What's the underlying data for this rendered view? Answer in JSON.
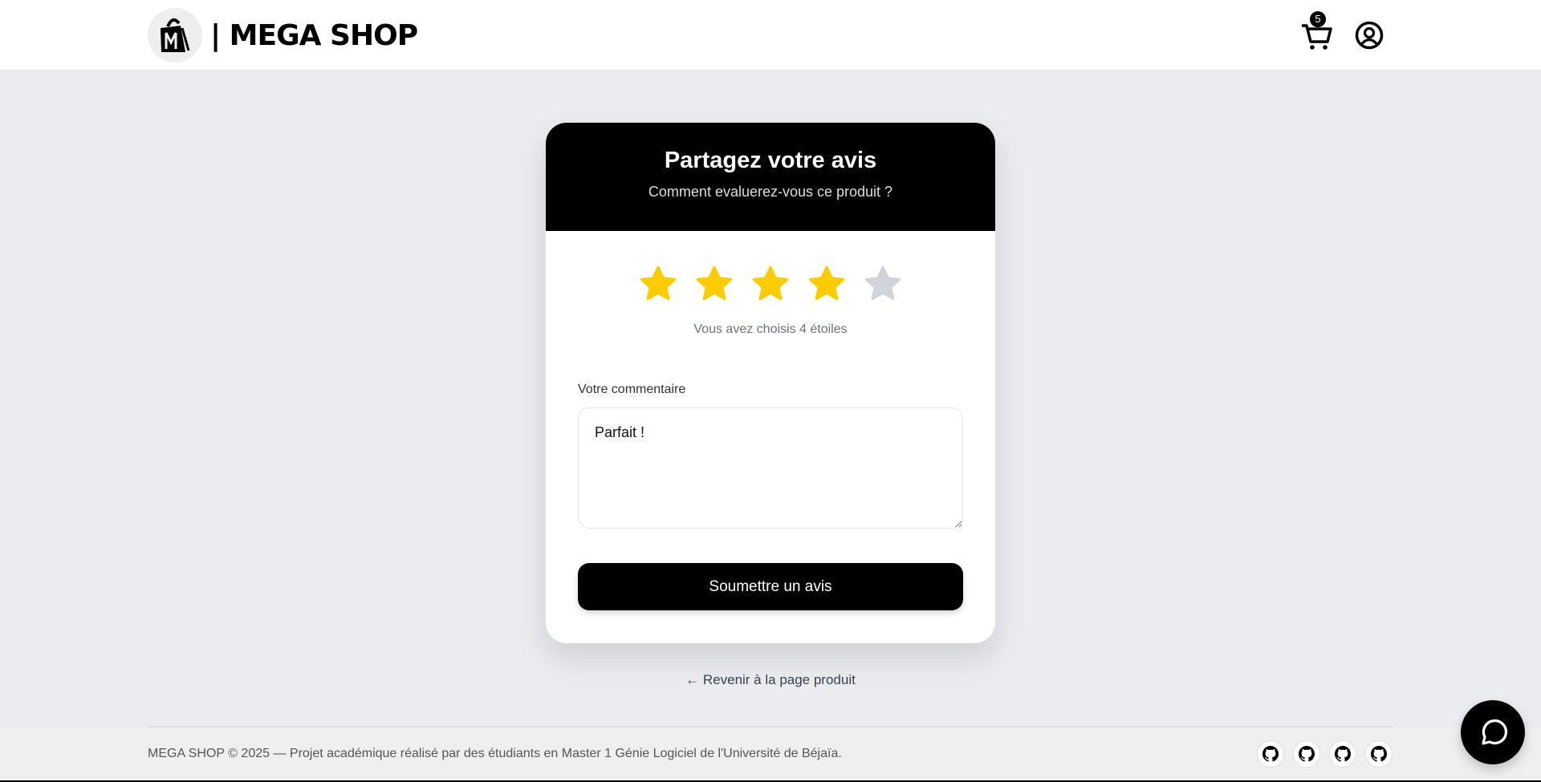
{
  "header": {
    "brand": "| MEGA SHOP",
    "logo_letter": "M",
    "cart_count": "5"
  },
  "card": {
    "title": "Partagez votre avis",
    "subtitle": "Comment evaluerez-vous ce produit ?",
    "rating": 4,
    "max_rating": 5,
    "rating_text": "Vous avez choisis 4 étoiles",
    "comment_label": "Votre commentaire",
    "comment_value": "Parfait !",
    "submit_label": "Soumettre un avis"
  },
  "back_link": "← Revenir à la page produit",
  "footer": {
    "text": "MEGA SHOP © 2025 — Projet académique réalisé par des étudiants en Master 1 Génie Logiciel de l'Université de Béjaïa."
  },
  "colors": {
    "star_on": "#fccb00",
    "star_off": "#d1d5db",
    "background": "#ebecf0"
  }
}
